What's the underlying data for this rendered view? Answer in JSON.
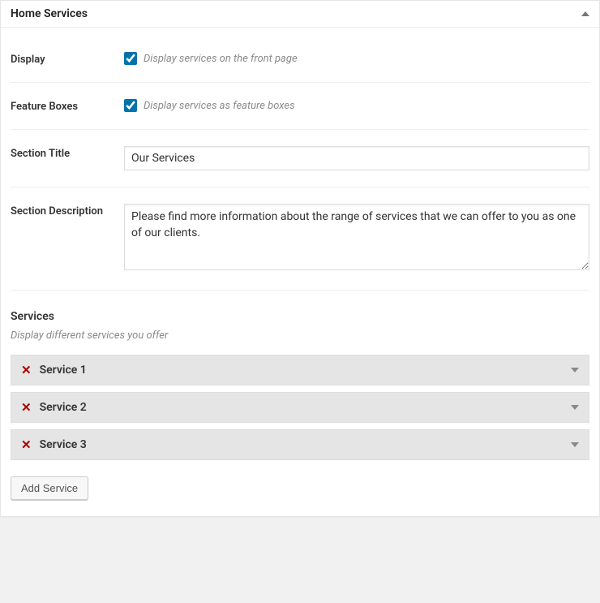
{
  "panel": {
    "title": "Home Services"
  },
  "fields": {
    "display": {
      "label": "Display",
      "checked": true,
      "description": "Display services on the front page"
    },
    "feature_boxes": {
      "label": "Feature Boxes",
      "checked": true,
      "description": "Display services as feature boxes"
    },
    "section_title": {
      "label": "Section Title",
      "value": "Our Services"
    },
    "section_description": {
      "label": "Section Description",
      "value": "Please find more information about the range of services that we can offer to you as one of our clients."
    }
  },
  "services": {
    "heading": "Services",
    "subheading": "Display different services you offer",
    "items": [
      {
        "title": "Service 1"
      },
      {
        "title": "Service 2"
      },
      {
        "title": "Service 3"
      }
    ],
    "add_button": "Add Service"
  }
}
